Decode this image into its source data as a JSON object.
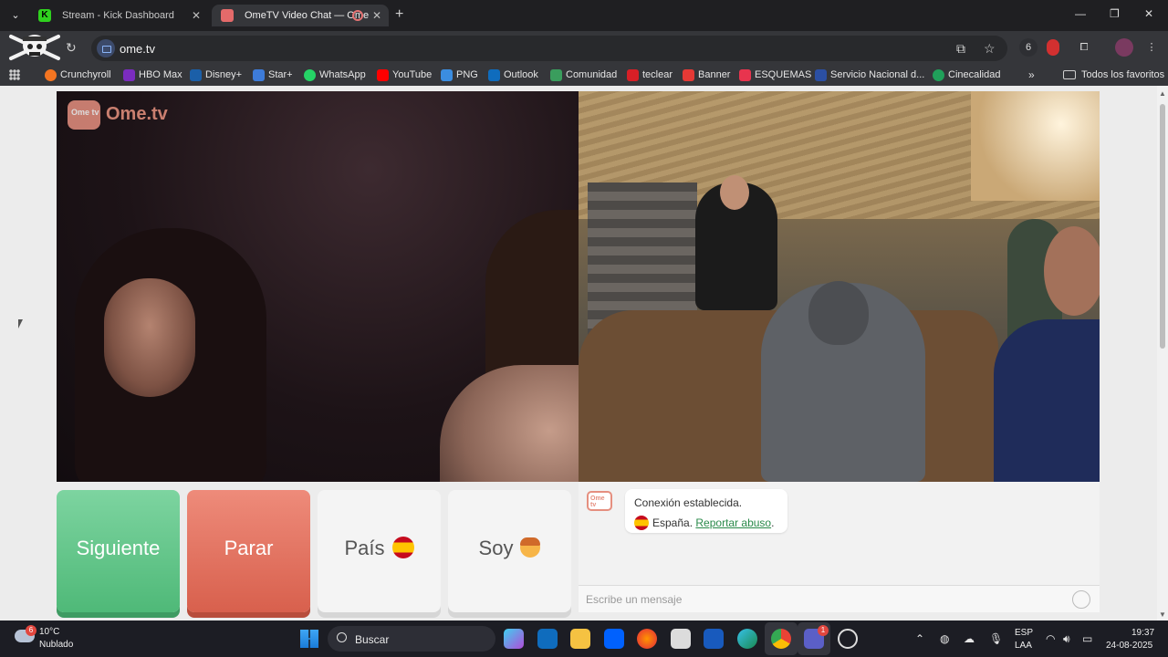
{
  "browser": {
    "tabs": [
      {
        "label": "Stream - Kick Dashboard",
        "favicon": "K"
      },
      {
        "label": "OmeTV Video Chat — Ome",
        "active": true
      }
    ],
    "url": "ome.tv",
    "extension_badge": "6",
    "bookmarks": [
      {
        "label": "Crunchyroll",
        "color": "#f47521"
      },
      {
        "label": "HBO Max",
        "color": "#7b2cbf"
      },
      {
        "label": "Disney+",
        "color": "#1b5fa8"
      },
      {
        "label": "Star+",
        "color": "#3d7bd9"
      },
      {
        "label": "WhatsApp",
        "color": "#25d366"
      },
      {
        "label": "YouTube",
        "color": "#ff0000"
      },
      {
        "label": "PNG",
        "color": "#3b8de0"
      },
      {
        "label": "Outlook",
        "color": "#0f6cbd"
      },
      {
        "label": "Comunidad",
        "color": "#3a9d5d"
      },
      {
        "label": "teclear",
        "color": "#d71f26"
      },
      {
        "label": "Banner",
        "color": "#e53935"
      },
      {
        "label": "ESQUEMAS",
        "color": "#e8344e"
      },
      {
        "label": "Servicio Nacional d...",
        "color": "#2b4fa3"
      },
      {
        "label": "Cinecalidad",
        "color": "#20a05a"
      }
    ],
    "all_bookmarks": "Todos los favoritos"
  },
  "ometv": {
    "logo_badge": "Ome tv",
    "logo_text": "Ome.tv",
    "buttons": {
      "next": "Siguiente",
      "stop": "Parar",
      "country": "País",
      "gender": "Soy"
    },
    "chat": {
      "status": "Conexión establecida.",
      "country": "España.",
      "report_link": "Reportar abuso",
      "report_suffix": ".",
      "input_placeholder": "Escribe un mensaje"
    }
  },
  "taskbar": {
    "weather_badge": "6",
    "temperature": "10°C",
    "condition": "Nublado",
    "search_label": "Buscar",
    "lang_line1": "ESP",
    "lang_line2": "LAA",
    "time": "19:37",
    "date": "24-08-2025",
    "teams_badge": "1"
  }
}
